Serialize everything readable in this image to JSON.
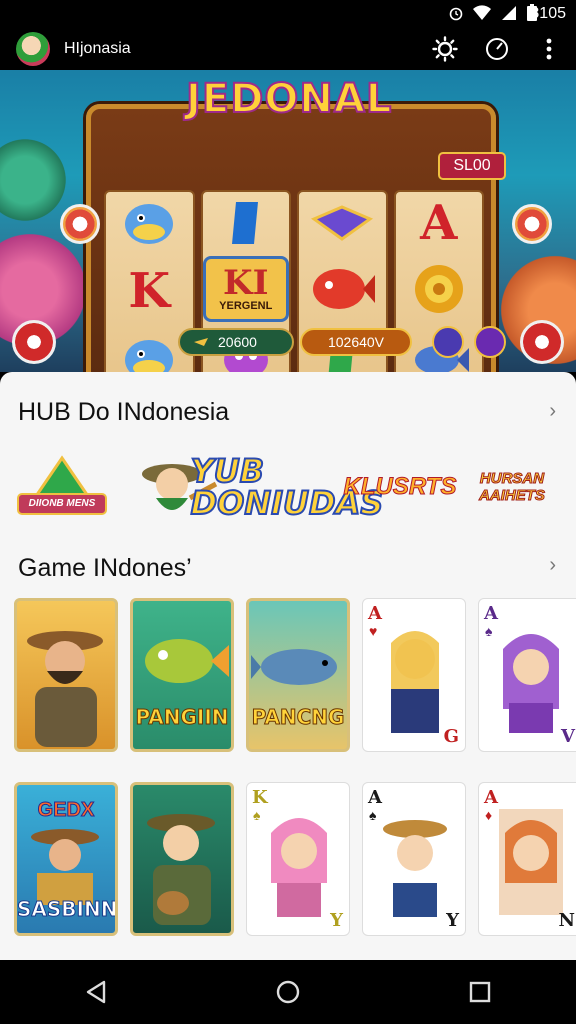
{
  "status_bar": {
    "time": "8105"
  },
  "app_bar": {
    "title": "HIjonasia"
  },
  "banner": {
    "slot_title": "JEDONAL",
    "badge": "SL00",
    "center_symbol": "KI",
    "center_symbol_sub": "YERGENL",
    "counter_left": "20600",
    "counter_right": "102640V",
    "reel_letters": [
      "K",
      "A"
    ]
  },
  "hub_section": {
    "title": "HUB Do INdonesia",
    "logos": [
      "DIIONB MENS",
      "YUB DONIUDAS",
      "KLUSRTS",
      "HURSAN AAIHETS"
    ]
  },
  "game_section": {
    "title": "Game INdones’",
    "row1": [
      {
        "kind": "gold",
        "label": ""
      },
      {
        "kind": "green",
        "label": "PANGIIN"
      },
      {
        "kind": "green",
        "label": "PANCNG"
      },
      {
        "kind": "play",
        "corner": "A",
        "suit": "♥",
        "bottom": "G"
      },
      {
        "kind": "play",
        "corner": "A",
        "suit": "♠",
        "bottom": "V"
      }
    ],
    "row2": [
      {
        "kind": "green",
        "label": "SASBINN",
        "top_label": "GEDX"
      },
      {
        "kind": "green",
        "label": ""
      },
      {
        "kind": "play",
        "corner": "K",
        "suit": "♠",
        "bottom": "Y"
      },
      {
        "kind": "play",
        "corner": "A",
        "suit": "♠",
        "bottom": "Y"
      },
      {
        "kind": "play",
        "corner": "A",
        "suit": "♦",
        "bottom": "N"
      }
    ]
  }
}
